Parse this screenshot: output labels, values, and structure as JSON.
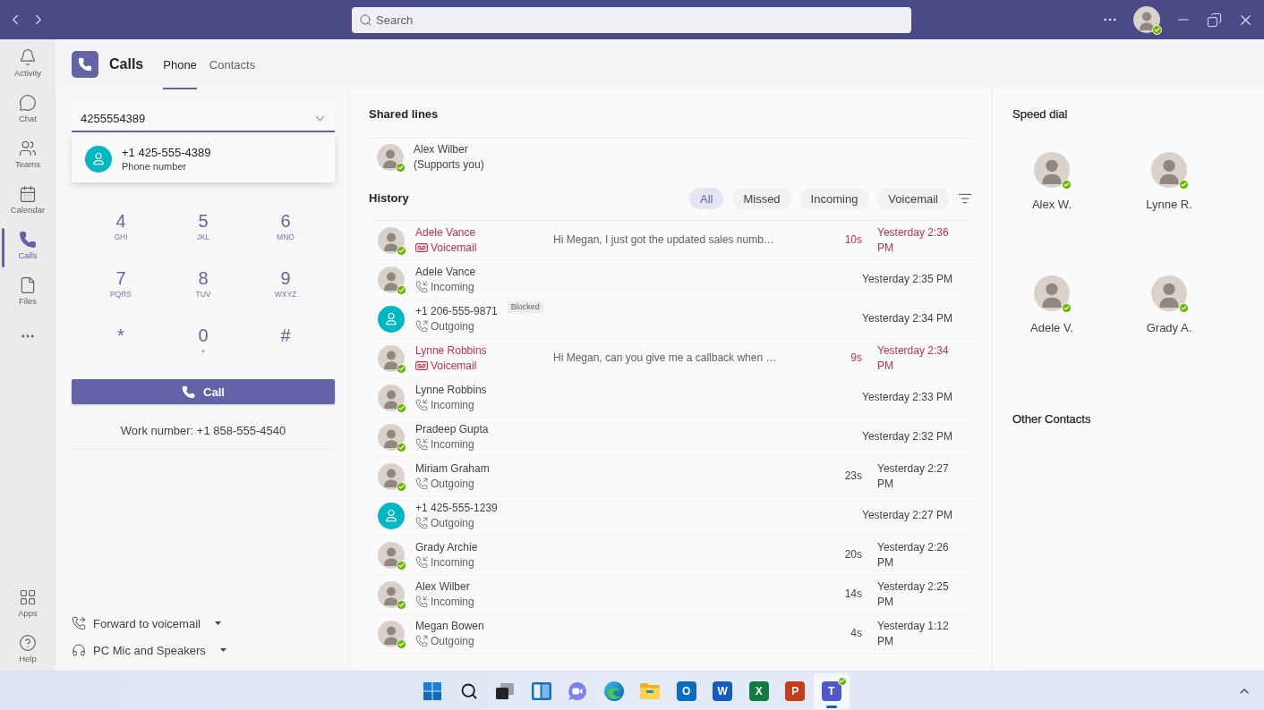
{
  "titlebar": {
    "search": {
      "placeholder": "Search"
    },
    "user": {
      "avatar": {
        "kind": "photo"
      },
      "online": true
    }
  },
  "rail": {
    "items": [
      {
        "kind": "activity",
        "label": "Activity",
        "selected": false
      },
      {
        "kind": "chat",
        "label": "Chat",
        "selected": false
      },
      {
        "kind": "teams",
        "label": "Teams",
        "selected": false
      },
      {
        "kind": "calendar",
        "label": "Calendar",
        "selected": false
      },
      {
        "kind": "calls",
        "label": "Calls",
        "selected": true
      },
      {
        "kind": "files",
        "label": "Files",
        "selected": false
      }
    ],
    "bottom_items": [
      {
        "kind": "apps",
        "label": "Apps",
        "selected": false
      },
      {
        "kind": "help",
        "label": "Help",
        "selected": false
      }
    ]
  },
  "header": {
    "title": "Calls",
    "tabs": [
      {
        "label": "Phone",
        "selected": true
      },
      {
        "label": "Contacts",
        "selected": false
      }
    ]
  },
  "dialer": {
    "input": {
      "value": "4255554389"
    },
    "suggestion": {
      "avatar": {
        "kind": "number"
      },
      "number": "+1 425-555-4389",
      "type": "Phone number"
    },
    "keypad": [
      {
        "digit": "4",
        "letters": "GHI"
      },
      {
        "digit": "5",
        "letters": "JKL"
      },
      {
        "digit": "6",
        "letters": "MNO"
      },
      {
        "digit": "7",
        "letters": "PQRS"
      },
      {
        "digit": "8",
        "letters": "TUV"
      },
      {
        "digit": "9",
        "letters": "WXYZ"
      },
      {
        "digit": "*"
      },
      {
        "digit": "0",
        "letters": "+"
      },
      {
        "digit": "#"
      }
    ],
    "call_button": "Call",
    "work_number": "Work number: +1 858-555-4540",
    "options": [
      {
        "kind": "forward",
        "label": "Forward to voicemail"
      },
      {
        "kind": "audio",
        "label": "PC Mic and Speakers"
      }
    ]
  },
  "shared_lines": {
    "title": "Shared lines",
    "items": [
      {
        "name": "Alex Wilber",
        "note": "(Supports you)",
        "avatar": {
          "kind": "photo"
        },
        "online": true
      }
    ]
  },
  "history": {
    "title": "History",
    "filters": [
      {
        "label": "All",
        "selected": true
      },
      {
        "label": "Missed",
        "selected": false
      },
      {
        "label": "Incoming",
        "selected": false
      },
      {
        "label": "Voicemail",
        "selected": false
      }
    ],
    "rows": [
      {
        "name": "Adele Vance",
        "avatar": {
          "kind": "photo"
        },
        "online": true,
        "kind": "voicemail",
        "call_type": "Voicemail",
        "preview": "Hi Megan, I just got the updated sales numb…",
        "duration": "10s",
        "time": "Yesterday 2:36 PM"
      },
      {
        "name": "Adele Vance",
        "avatar": {
          "kind": "photo"
        },
        "online": true,
        "kind": "incoming",
        "call_type": "Incoming",
        "time": "Yesterday 2:35 PM"
      },
      {
        "name": "+1 206-555-9871",
        "avatar": {
          "kind": "number"
        },
        "online": false,
        "badge": "Blocked",
        "kind": "outgoing",
        "call_type": "Outgoing",
        "time": "Yesterday 2:34 PM"
      },
      {
        "name": "Lynne Robbins",
        "avatar": {
          "kind": "photo"
        },
        "online": true,
        "kind": "voicemail",
        "call_type": "Voicemail",
        "preview": "Hi Megan, can you give me a callback when …",
        "duration": "9s",
        "time": "Yesterday 2:34 PM"
      },
      {
        "name": "Lynne Robbins",
        "avatar": {
          "kind": "photo"
        },
        "online": true,
        "kind": "incoming",
        "call_type": "Incoming",
        "time": "Yesterday 2:33 PM"
      },
      {
        "name": "Pradeep Gupta",
        "avatar": {
          "kind": "photo"
        },
        "online": true,
        "kind": "incoming",
        "call_type": "Incoming",
        "time": "Yesterday 2:32 PM"
      },
      {
        "name": "Miriam Graham",
        "avatar": {
          "kind": "photo"
        },
        "online": true,
        "kind": "outgoing",
        "call_type": "Outgoing",
        "duration": "23s",
        "time": "Yesterday 2:27 PM"
      },
      {
        "name": "+1 425-555-1239",
        "avatar": {
          "kind": "number"
        },
        "online": false,
        "kind": "outgoing",
        "call_type": "Outgoing",
        "time": "Yesterday 2:27 PM"
      },
      {
        "name": "Grady Archie",
        "avatar": {
          "kind": "photo"
        },
        "online": true,
        "kind": "incoming",
        "call_type": "Incoming",
        "duration": "20s",
        "time": "Yesterday 2:26 PM"
      },
      {
        "name": "Alex Wilber",
        "avatar": {
          "kind": "photo"
        },
        "online": true,
        "kind": "incoming",
        "call_type": "Incoming",
        "duration": "14s",
        "time": "Yesterday 2:25 PM"
      },
      {
        "name": "Megan Bowen",
        "avatar": {
          "kind": "photo"
        },
        "online": true,
        "kind": "outgoing",
        "call_type": "Outgoing",
        "duration": "4s",
        "time": "Yesterday 1:12 PM"
      }
    ]
  },
  "speed_dial": {
    "title": "Speed dial",
    "contacts": [
      {
        "name": "Alex W.",
        "avatar": {
          "kind": "photo"
        },
        "online": true
      },
      {
        "name": "Lynne R.",
        "avatar": {
          "kind": "photo"
        },
        "online": true
      },
      {
        "name": "Adele V.",
        "avatar": {
          "kind": "photo"
        },
        "online": true
      },
      {
        "name": "Grady A.",
        "avatar": {
          "kind": "photo"
        },
        "online": true
      }
    ]
  },
  "other_contacts": {
    "title": "Other Contacts"
  },
  "taskbar": {
    "apps": [
      {
        "kind": "start",
        "selected": false
      },
      {
        "kind": "search",
        "selected": false
      },
      {
        "kind": "task_view",
        "selected": false
      },
      {
        "kind": "widgets",
        "selected": false
      },
      {
        "kind": "chat",
        "selected": false
      },
      {
        "kind": "browser",
        "selected": false
      },
      {
        "kind": "folder",
        "selected": false
      },
      {
        "kind": "letter",
        "label": "O",
        "color": "#0f6cbd",
        "badge": false,
        "selected": false
      },
      {
        "kind": "letter",
        "label": "W",
        "color": "#185abd",
        "badge": false,
        "selected": false
      },
      {
        "kind": "letter",
        "label": "X",
        "color": "#107c41",
        "badge": false,
        "selected": false
      },
      {
        "kind": "letter",
        "label": "P",
        "color": "#c43e1c",
        "badge": false,
        "selected": false
      },
      {
        "kind": "letter",
        "label": "T",
        "color": "#5059c9",
        "badge": true,
        "selected": true
      }
    ]
  }
}
